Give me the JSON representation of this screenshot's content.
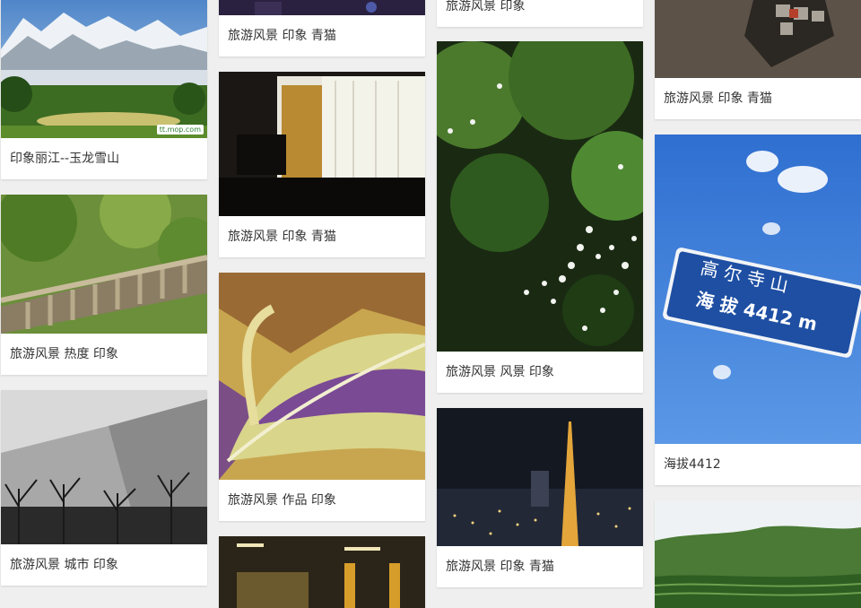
{
  "cards": [
    {
      "caption": "印象丽江--玉龙雪山",
      "watermark": "tt.mop.com"
    },
    {
      "caption": "旅游风景 热度 印象"
    },
    {
      "caption": "旅游风景 城市 印象"
    },
    {
      "caption": "旅游风景 印象 青猫"
    },
    {
      "caption": "旅游风景 印象 青猫"
    },
    {
      "caption": "旅游风景 作品 印象"
    },
    {
      "caption": "旅游风景 印象"
    },
    {
      "caption": "旅游风景 风景 印象"
    },
    {
      "caption": "旅游风景 印象 青猫"
    },
    {
      "caption": "旅游风景 印象 青猫"
    },
    {
      "caption": "海拔4412",
      "sign_line1": "高 尔 寺 山",
      "sign_line2": "海 拔 4412 m"
    }
  ]
}
